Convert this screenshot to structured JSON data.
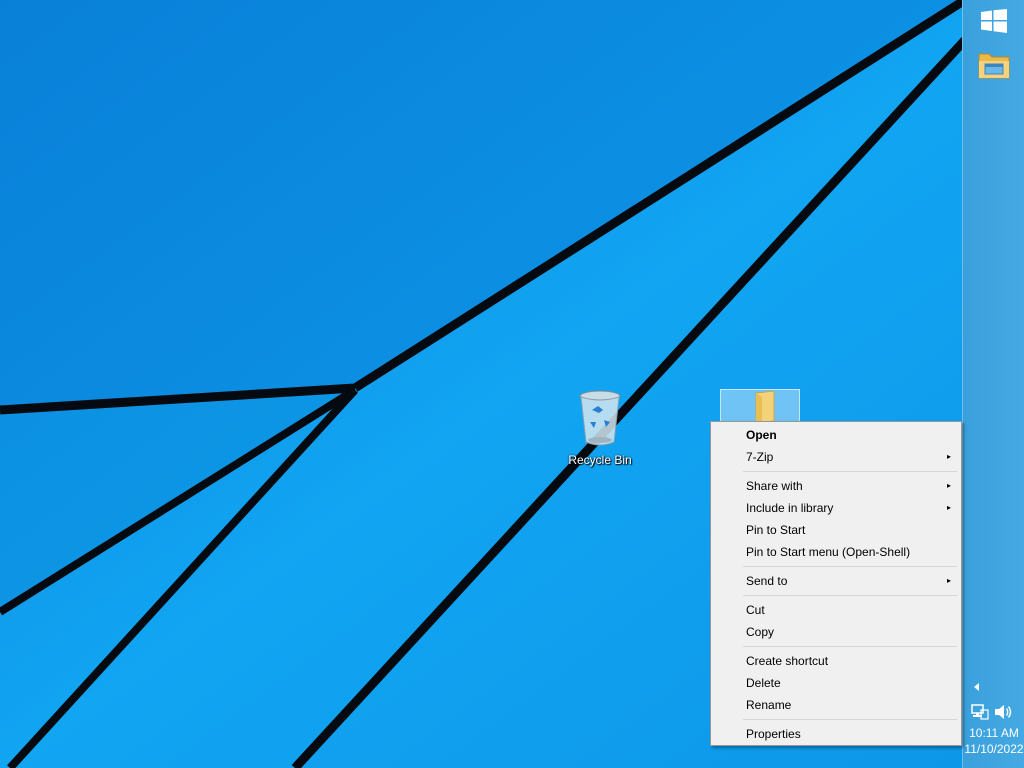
{
  "desktop": {
    "icons": [
      {
        "label": "Recycle Bin",
        "icon": "recycle-bin-icon"
      },
      {
        "label": "",
        "icon": "folder-icon",
        "selected": true
      }
    ]
  },
  "taskbar": {
    "start_icon": "windows-logo-icon",
    "pinned": [
      {
        "icon": "file-explorer-icon"
      }
    ],
    "tray": {
      "overflow_icon": "chevron-left-icon",
      "network_icon": "network-icon",
      "volume_icon": "speaker-icon"
    },
    "clock": {
      "time": "10:11 AM",
      "date": "11/10/2022"
    }
  },
  "context_menu": {
    "items": [
      {
        "label": "Open",
        "bold": true
      },
      {
        "label": "7-Zip",
        "submenu": true
      },
      {
        "separator": true
      },
      {
        "label": "Share with",
        "submenu": true
      },
      {
        "label": "Include in library",
        "submenu": true
      },
      {
        "label": "Pin to Start"
      },
      {
        "label": "Pin to Start menu (Open-Shell)"
      },
      {
        "separator": true
      },
      {
        "label": "Send to",
        "submenu": true
      },
      {
        "separator": true
      },
      {
        "label": "Cut"
      },
      {
        "label": "Copy"
      },
      {
        "separator": true
      },
      {
        "label": "Create shortcut"
      },
      {
        "label": "Delete"
      },
      {
        "label": "Rename"
      },
      {
        "separator": true
      },
      {
        "label": "Properties"
      }
    ],
    "submenu_arrow": "▸"
  },
  "colors": {
    "wallpaper_light": "#12a8f4",
    "wallpaper_dark": "#0670c8",
    "taskbar": "#3ea4de",
    "menu_background": "#f0f0f0"
  }
}
